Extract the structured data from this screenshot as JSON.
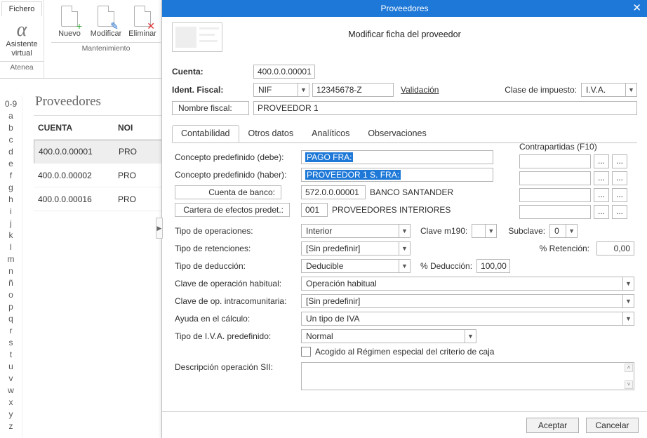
{
  "window_title": "Proveedores",
  "modal_title": "Proveedores",
  "modal_subtitle": "Modificar ficha del proveedor",
  "ribbon": {
    "tab": "Fichero",
    "assistant_top": "Asistente",
    "assistant_bot": "virtual",
    "brand": "Atenea",
    "nuevo": "Nuevo",
    "modificar": "Modificar",
    "eliminar": "Eliminar",
    "group": "Mantenimiento"
  },
  "alpha": [
    "0-9",
    "a",
    "b",
    "c",
    "d",
    "e",
    "f",
    "g",
    "h",
    "i",
    "j",
    "k",
    "l",
    "m",
    "n",
    "ñ",
    "o",
    "p",
    "q",
    "r",
    "s",
    "t",
    "u",
    "v",
    "w",
    "x",
    "y",
    "z"
  ],
  "list": {
    "title": "Proveedores",
    "h1": "CUENTA",
    "h2": "NOI",
    "rows": [
      {
        "c": "400.0.0.00001",
        "n": "PRO",
        "sel": true
      },
      {
        "c": "400.0.0.00002",
        "n": "PRO",
        "sel": false
      },
      {
        "c": "400.0.0.00016",
        "n": "PRO",
        "sel": false
      }
    ]
  },
  "header": {
    "cuenta_l": "Cuenta:",
    "cuenta_v": "400.0.0.00001",
    "ident_l": "Ident. Fiscal:",
    "ident_type": "NIF",
    "ident_v": "12345678-Z",
    "valid": "Validación",
    "clase_l": "Clase de impuesto:",
    "clase_v": "I.V.A.",
    "nombre_l": "Nombre fiscal:",
    "nombre_v": "PROVEEDOR 1"
  },
  "tabs": {
    "t1": "Contabilidad",
    "t2": "Otros datos",
    "t3": "Analíticos",
    "t4": "Observaciones"
  },
  "tab1": {
    "debe_l": "Concepto predefinido (debe):",
    "debe_v": "PAGO FRA:",
    "haber_l": "Concepto predefinido (haber):",
    "haber_v": "PROVEEDOR 1 S. FRA:",
    "banco_l": "Cuenta de banco:",
    "banco_c": "572.0.0.00001",
    "banco_n": "BANCO SANTANDER",
    "cartera_l": "Cartera de efectos predet.:",
    "cartera_c": "001",
    "cartera_n": "PROVEEDORES INTERIORES",
    "ops_l": "Tipo de operaciones:",
    "ops_v": "Interior",
    "clavem_l": "Clave m190:",
    "subclave_l": "Subclave:",
    "subclave_v": "0",
    "ret_l": "Tipo de retenciones:",
    "ret_v": "[Sin predefinir]",
    "retp_l": "% Retención:",
    "retp_v": "0,00",
    "ded_l": "Tipo de deducción:",
    "ded_v": "Deducible",
    "dedp_l": "% Deducción:",
    "dedp_v": "100,00",
    "clavh_l": "Clave de operación habitual:",
    "clavh_v": "Operación habitual",
    "clavic_l": "Clave de op. intracomunitaria:",
    "clavic_v": "[Sin predefinir]",
    "ayuda_l": "Ayuda en el cálculo:",
    "ayuda_v": "Un tipo de IVA",
    "iva_l": "Tipo de I.V.A. predefinido:",
    "iva_v": "Normal",
    "chk_l": "Acogido al Régimen especial del criterio de caja",
    "desc_l": "Descripción operación SII:",
    "contrap_l": "Contrapartidas (F10)"
  },
  "footer": {
    "ok": "Aceptar",
    "cancel": "Cancelar"
  }
}
